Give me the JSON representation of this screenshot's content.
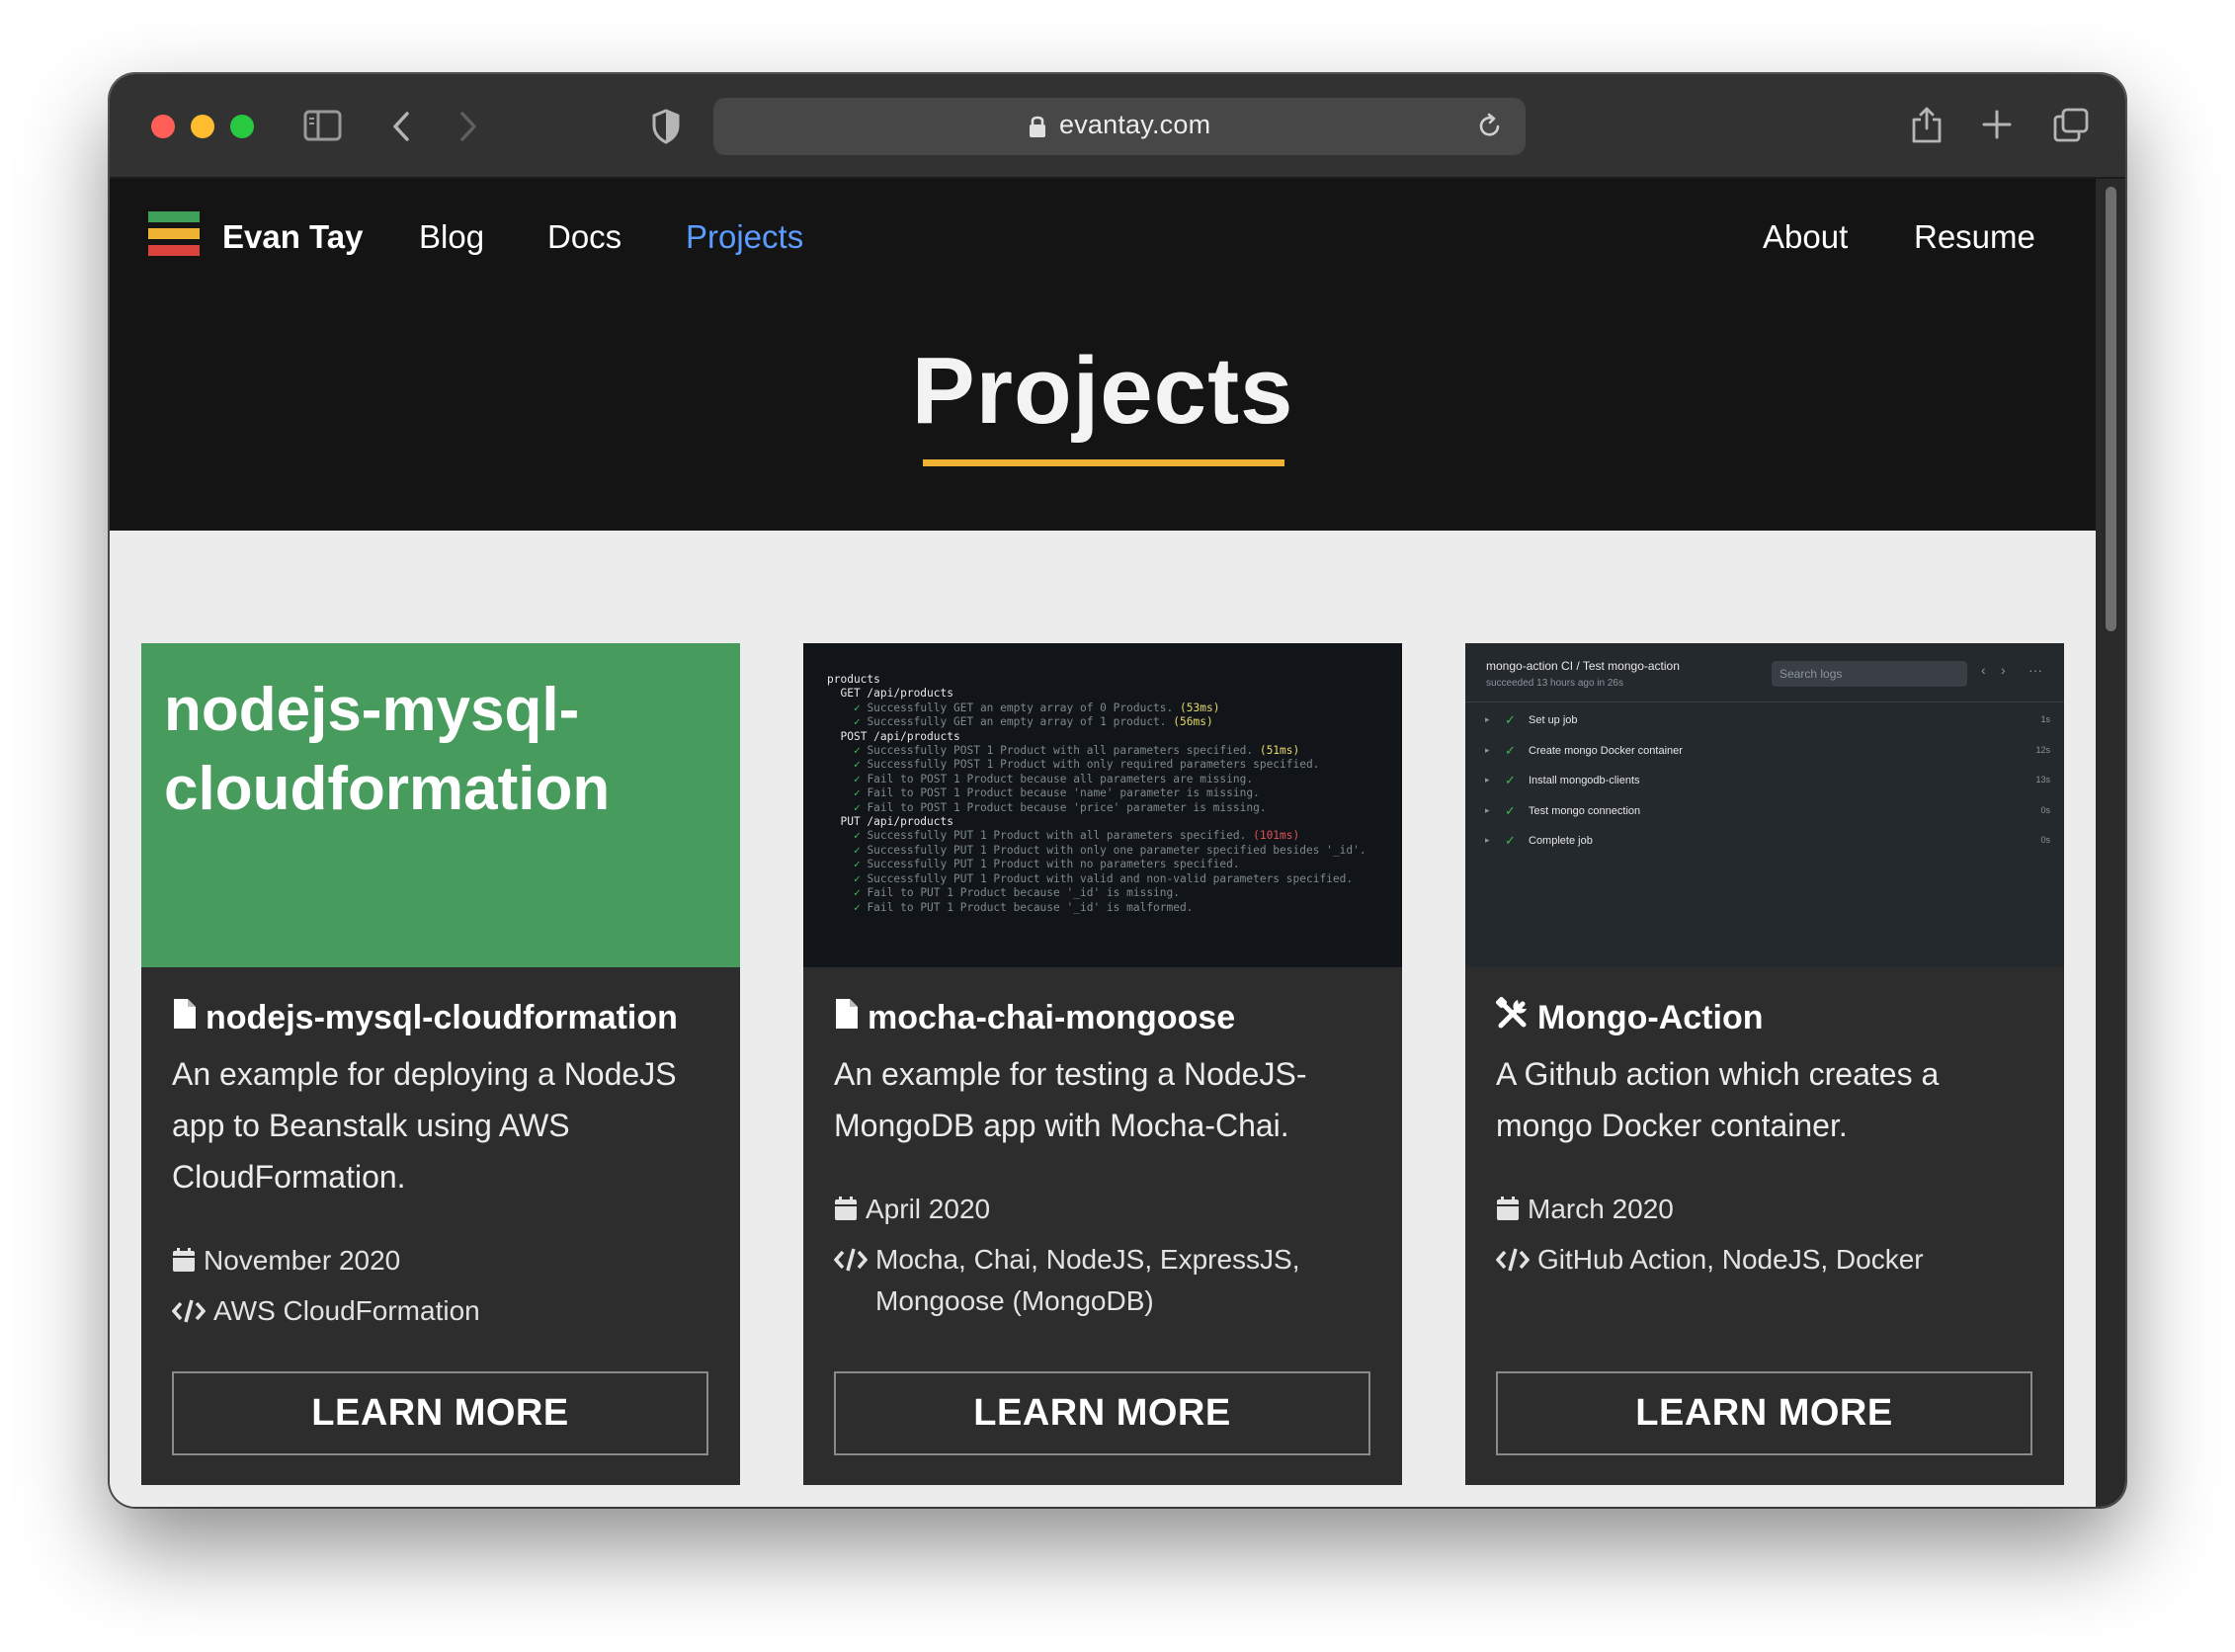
{
  "browser": {
    "url": "evantay.com"
  },
  "nav": {
    "brand": "Evan Tay",
    "links": [
      "Blog",
      "Docs",
      "Projects",
      "About",
      "Resume"
    ],
    "active_link": "Projects",
    "logo_colors": [
      "#3fa05a",
      "#f0b233",
      "#d9433b"
    ]
  },
  "hero": {
    "title": "Projects",
    "underline_color": "#f0b233"
  },
  "cards": [
    {
      "image_title": "nodejs-mysql-cloudformation",
      "icon": "file-icon",
      "title": "nodejs-mysql-cloudformation",
      "description": "An example for deploying a NodeJS app to Beanstalk using AWS CloudFormation.",
      "date": "November 2020",
      "tech": "AWS CloudFormation",
      "button": "LEARN MORE"
    },
    {
      "icon": "file-icon",
      "title": "mocha-chai-mongoose",
      "description": "An example for testing a NodeJS-MongoDB app with Mocha-Chai.",
      "date": "April 2020",
      "tech": "Mocha, Chai, NodeJS, ExpressJS, Mongoose (MongoDB)",
      "button": "LEARN MORE",
      "terminal": [
        "products",
        "  GET /api/products",
        "    ✓ Successfully GET an empty array of 0 Products. (53ms)",
        "    ✓ Successfully GET an empty array of 1 product. (56ms)",
        "  POST /api/products",
        "    ✓ Successfully POST 1 Product with all parameters specified. (51ms)",
        "    ✓ Successfully POST 1 Product with only required parameters specified.",
        "    ✓ Fail to POST 1 Product because all parameters are missing.",
        "    ✓ Fail to POST 1 Product because 'name' parameter is missing.",
        "    ✓ Fail to POST 1 Product because 'price' parameter is missing.",
        "  PUT /api/products",
        "    ✓ Successfully PUT 1 Product with all parameters specified. (101ms)",
        "    ✓ Successfully PUT 1 Product with only one parameter specified besides '_id'.",
        "    ✓ Successfully PUT 1 Product with no parameters specified.",
        "    ✓ Successfully PUT 1 Product with valid and non-valid parameters specified.",
        "    ✓ Fail to PUT 1 Product because '_id' is missing.",
        "    ✓ Fail to PUT 1 Product because '_id' is malformed."
      ]
    },
    {
      "icon": "tools-icon",
      "title": "Mongo-Action",
      "description": "A Github action which creates a mongo Docker container.",
      "date": "March 2020",
      "tech": "GitHub Action, NodeJS, Docker",
      "button": "LEARN MORE",
      "actions": {
        "title": "mongo-action CI / Test mongo-action",
        "subtitle": "succeeded 13 hours ago in 26s",
        "search_placeholder": "Search logs",
        "steps": [
          {
            "label": "Set up job",
            "duration": "1s"
          },
          {
            "label": "Create mongo Docker container",
            "duration": "12s"
          },
          {
            "label": "Install mongodb-clients",
            "duration": "13s"
          },
          {
            "label": "Test mongo connection",
            "duration": "0s"
          },
          {
            "label": "Complete job",
            "duration": "0s"
          }
        ]
      }
    }
  ]
}
